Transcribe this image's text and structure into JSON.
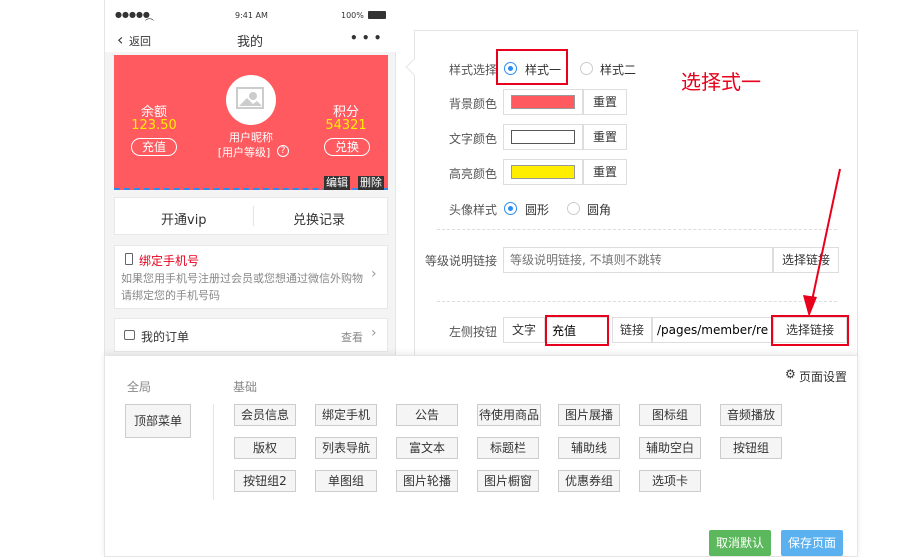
{
  "status": {
    "signal": "●●●●● ",
    "time": "9:41 AM",
    "battery": "100%"
  },
  "nav": {
    "back": "返回",
    "title": "我的",
    "more": "• • •"
  },
  "hero": {
    "balance_label": "余额",
    "balance_value": "123.50",
    "recharge": "充值",
    "nickname": "用户昵称",
    "level": "[用户等级]",
    "points_label": "积分",
    "points_value": "54321",
    "exchange": "兑换",
    "edit": "编辑",
    "delete": "删除"
  },
  "links": {
    "vip": "开通vip",
    "records": "兑换记录"
  },
  "bind": {
    "title": "绑定手机号",
    "desc": "如果您用手机号注册过会员或您想通过微信外购物请绑定您的手机号码"
  },
  "orders": {
    "title": "我的订单",
    "view": "查看"
  },
  "form": {
    "style_label": "样式选择",
    "style1": "样式一",
    "style2": "样式二",
    "bg_label": "背景颜色",
    "text_label": "文字颜色",
    "hl_label": "高亮颜色",
    "reset": "重置",
    "avatar_label": "头像样式",
    "round": "圆形",
    "corner": "圆角",
    "level_label": "等级说明链接",
    "level_placeholder": "等级说明链接, 不填则不跳转",
    "choose_link": "选择链接",
    "left_label": "左侧按钮",
    "text": "文字",
    "left_value": "充值",
    "link": "链接",
    "left_url": "/pages/member/re"
  },
  "annotation": "选择式一",
  "bottom": {
    "global": "全局",
    "basic": "基础",
    "top_menu": "顶部菜单",
    "page_settings": "页面设置",
    "components": [
      "会员信息",
      "绑定手机",
      "公告",
      "待使用商品",
      "图片展播",
      "图标组",
      "音频播放",
      "版权",
      "列表导航",
      "富文本",
      "标题栏",
      "辅助线",
      "辅助空白",
      "按钮组",
      "按钮组2",
      "单图组",
      "图片轮播",
      "图片橱窗",
      "优惠券组",
      "选项卡"
    ],
    "cancel_default": "取消默认",
    "save_page": "保存页面"
  },
  "colors": {
    "bg": "#ff5a5f",
    "text": "#ffffff",
    "highlight": "#ffee00",
    "accent": "#2d8cf0",
    "red": "#e8001c",
    "green": "#5cb85c",
    "blue": "#5bb1f0"
  }
}
